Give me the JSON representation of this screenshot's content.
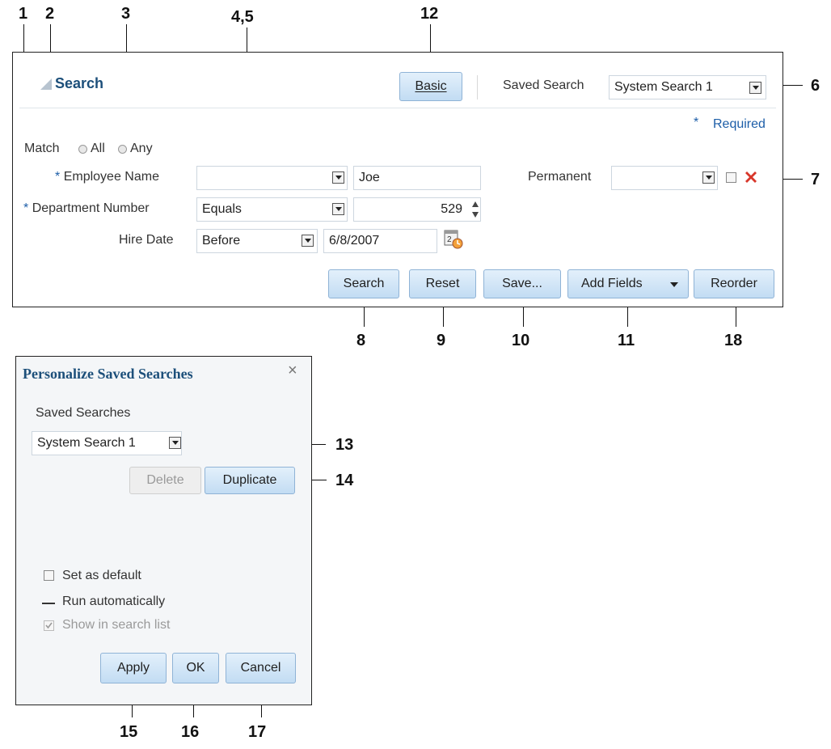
{
  "callouts": {
    "c1": "1",
    "c2": "2",
    "c3": "3",
    "c45": "4,5",
    "c12": "12",
    "c6": "6",
    "c7": "7",
    "c8": "8",
    "c9": "9",
    "c10": "10",
    "c11": "11",
    "c18": "18",
    "c13": "13",
    "c14": "14",
    "c15": "15",
    "c16": "16",
    "c17": "17"
  },
  "search_panel": {
    "title": "Search",
    "basic_button": "Basic",
    "saved_search_label": "Saved Search",
    "saved_search_value": "System Search 1",
    "required_marker": "*",
    "required_text": "Required",
    "match_label": "Match",
    "match_all": "All",
    "match_any": "Any",
    "employee_name": {
      "label": "Employee Name",
      "operator": "",
      "value": "Joe"
    },
    "department_number": {
      "label": "Department Number",
      "operator": "Equals",
      "value": "529"
    },
    "hire_date": {
      "label": "Hire Date",
      "operator": "Before",
      "value": "6/8/2007"
    },
    "permanent": {
      "label": "Permanent",
      "value": ""
    },
    "buttons": {
      "search": "Search",
      "reset": "Reset",
      "save": "Save...",
      "add_fields": "Add Fields",
      "reorder": "Reorder"
    }
  },
  "dialog": {
    "title": "Personalize Saved Searches",
    "close": "×",
    "saved_searches_label": "Saved Searches",
    "saved_searches_value": "System Search 1",
    "delete": "Delete",
    "duplicate": "Duplicate",
    "set_as_default": "Set as default",
    "run_automatically": "Run automatically",
    "show_in_search_list": "Show in search list",
    "apply": "Apply",
    "ok": "OK",
    "cancel": "Cancel"
  },
  "colors": {
    "accent": "#1c4f7a",
    "button": "#c2dcf3",
    "required": "#1d5ea8"
  }
}
